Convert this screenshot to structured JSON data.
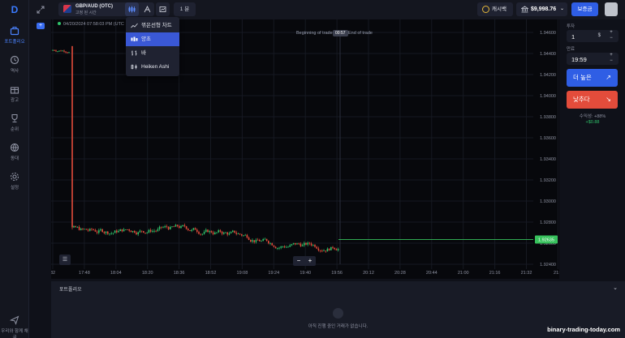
{
  "nav": {
    "items": [
      {
        "label": "포트폴리오",
        "icon": "briefcase-icon"
      },
      {
        "label": "역사",
        "icon": "history-icon"
      },
      {
        "label": "광고",
        "icon": "gift-icon"
      },
      {
        "label": "순위",
        "icon": "trophy-icon"
      },
      {
        "label": "동대",
        "icon": "globe-icon"
      },
      {
        "label": "설정",
        "icon": "gear-icon"
      }
    ],
    "support_label": "우리와 함께 채굴"
  },
  "topbar": {
    "asset_name": "GBP/AUD (OTC)",
    "asset_sub": "고정 된 시간",
    "timeframe": "1 분",
    "cashback": "캐시백",
    "balance": "$9,998.76",
    "deposit": "보증금"
  },
  "dropdown": {
    "items": [
      {
        "label": "꺾은선형 차트",
        "icon": "line-chart-icon",
        "active": false
      },
      {
        "label": "양초",
        "icon": "candles-icon",
        "active": true
      },
      {
        "label": "바",
        "icon": "bars-icon",
        "active": false
      },
      {
        "label": "Heiken Ashi",
        "icon": "heiken-ashi-icon",
        "active": false
      }
    ]
  },
  "chart": {
    "timestamp": "04/20/2024 07:58:03 PM (UTC",
    "beginning_label": "Beginning of trade",
    "countdown": "00:57",
    "end_label": "End of trade",
    "current_price": "1.92635",
    "colors": {
      "up": "#2fc26a",
      "down": "#e34c3b",
      "price_line": "#37c15c"
    }
  },
  "chart_data": {
    "type": "candlestick",
    "x_ticks": [
      "32",
      "17:48",
      "18:04",
      "18:20",
      "18:36",
      "18:52",
      "19:08",
      "19:24",
      "19:40",
      "19:56",
      "20:12",
      "20:28",
      "20:44",
      "21:00",
      "21:16",
      "21:32",
      "21:4"
    ],
    "y_ticks": [
      "1.94600",
      "1.94400",
      "1.94200",
      "1.94000",
      "1.93800",
      "1.93600",
      "1.93400",
      "1.93200",
      "1.93000",
      "1.92800",
      "1.92600",
      "1.92400"
    ],
    "ylim": [
      1.924,
      1.946
    ],
    "current_price": 1.92635,
    "series": [
      {
        "segment": "high-plateau",
        "x_start": "32",
        "x_end": "17:48",
        "price": 1.9447
      },
      {
        "segment": "crash",
        "x": "17:48",
        "from": 1.9447,
        "to": 1.9275
      },
      {
        "segment": "range",
        "x_start": "17:48",
        "x_end": "19:56",
        "low": 1.9258,
        "high": 1.9278
      }
    ]
  },
  "trade": {
    "amount_label": "투자",
    "amount_value": "1",
    "amount_unit": "$",
    "time_label": "만료",
    "time_value": "19:59",
    "higher_label": "더 높은",
    "lower_label": "낮추다",
    "profit_label": "수익성: +88%",
    "payout_label": "+$0.88"
  },
  "portfolio": {
    "title": "포트폴리오",
    "empty_text": "아직 진행 중인 거래가 없습니다."
  },
  "watermark": "binary-trading-today.com"
}
